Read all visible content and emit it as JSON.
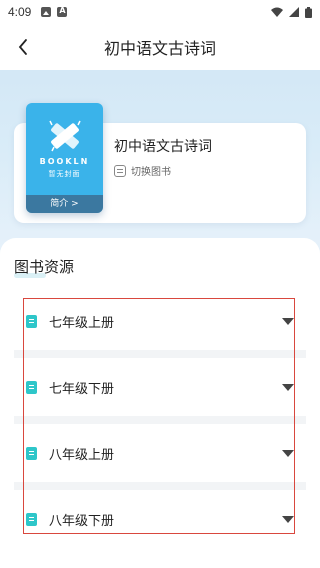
{
  "status_bar": {
    "time": "4:09",
    "icons": [
      "image-icon",
      "a-icon",
      "wifi-icon",
      "signal-icon",
      "battery-icon"
    ]
  },
  "nav": {
    "title": "初中语文古诗词",
    "back_icon": "chevron-left-icon"
  },
  "book": {
    "title": "初中语文古诗词",
    "switch_label": "切换图书",
    "cover_brand": "BOOKLN",
    "cover_sub": "暂无封面",
    "intro_label": "简介 >"
  },
  "section": {
    "title": "图书资源"
  },
  "grades": [
    {
      "label": "七年级上册"
    },
    {
      "label": "七年级下册"
    },
    {
      "label": "八年级上册"
    },
    {
      "label": "八年级下册"
    }
  ],
  "colors": {
    "accent": "#2ec6c9",
    "cover": "#3ab3ea",
    "highlight": "#d9473e"
  }
}
